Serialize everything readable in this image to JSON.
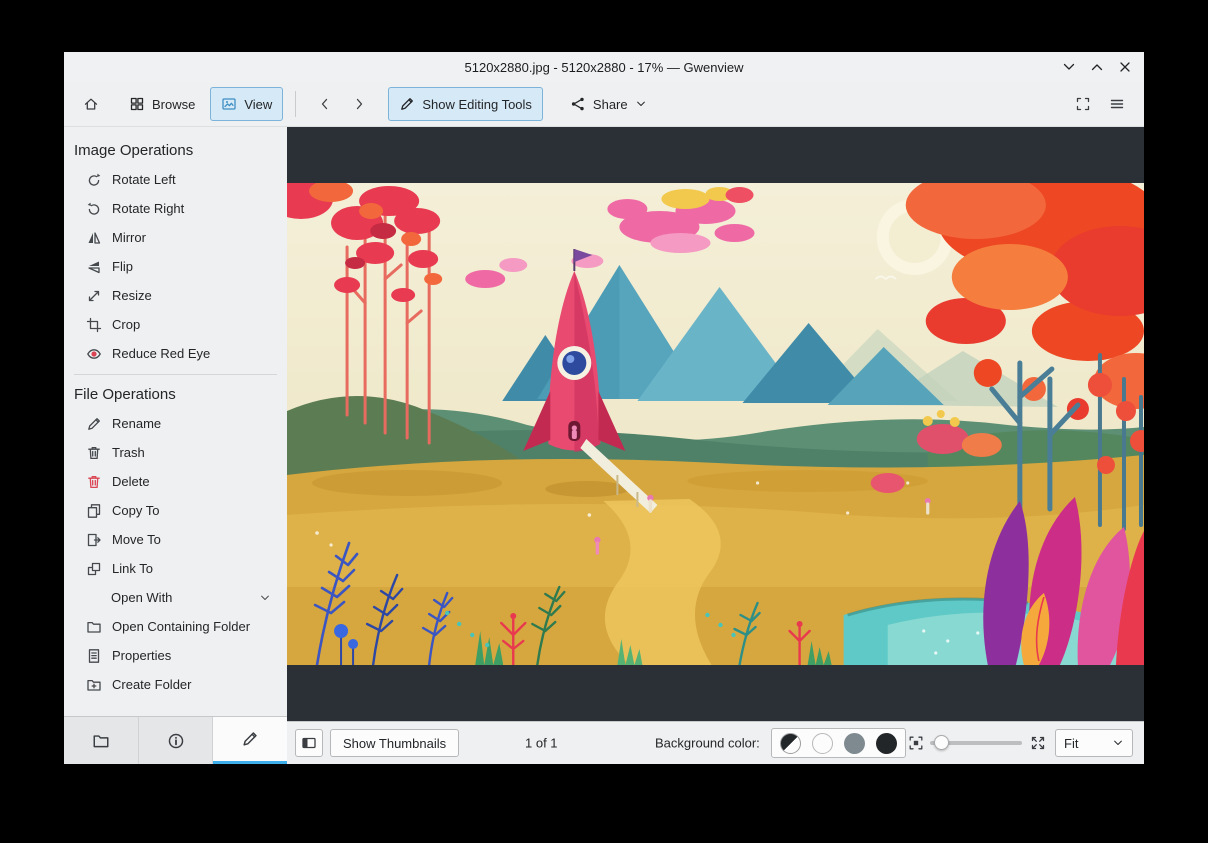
{
  "window": {
    "title": "5120x2880.jpg - 5120x2880 - 17% — Gwenview"
  },
  "toolbar": {
    "browse": "Browse",
    "view": "View",
    "show_editing_tools": "Show Editing Tools",
    "share": "Share"
  },
  "sidebar": {
    "image_operations_heading": "Image Operations",
    "image_operations": [
      {
        "label": "Rotate Left",
        "icon": "rotate-left-icon"
      },
      {
        "label": "Rotate Right",
        "icon": "rotate-right-icon"
      },
      {
        "label": "Mirror",
        "icon": "mirror-icon"
      },
      {
        "label": "Flip",
        "icon": "flip-icon"
      },
      {
        "label": "Resize",
        "icon": "resize-icon"
      },
      {
        "label": "Crop",
        "icon": "crop-icon"
      },
      {
        "label": "Reduce Red Eye",
        "icon": "red-eye-icon"
      }
    ],
    "file_operations_heading": "File Operations",
    "file_operations": [
      {
        "label": "Rename",
        "icon": "pencil-icon"
      },
      {
        "label": "Trash",
        "icon": "trash-icon"
      },
      {
        "label": "Delete",
        "icon": "delete-icon"
      },
      {
        "label": "Copy To",
        "icon": "copy-icon"
      },
      {
        "label": "Move To",
        "icon": "move-icon"
      },
      {
        "label": "Link To",
        "icon": "link-icon"
      },
      {
        "label": "Open With",
        "has_submenu": true
      },
      {
        "label": "Open Containing Folder",
        "icon": "folder-icon"
      },
      {
        "label": "Properties",
        "icon": "properties-icon"
      },
      {
        "label": "Create Folder",
        "icon": "new-folder-icon"
      }
    ]
  },
  "statusbar": {
    "show_thumbnails": "Show Thumbnails",
    "page_indicator": "1 of 1",
    "background_color_label": "Background color:",
    "zoom_mode": "Fit"
  },
  "icons": {
    "window_controls": [
      "minimize-chevron-down-icon",
      "maximize-chevron-up-icon",
      "close-x-icon"
    ],
    "toolbar": [
      "home-icon",
      "browse-grid-icon",
      "view-image-icon",
      "back-chevron-icon",
      "forward-chevron-icon",
      "pencil-icon",
      "share-icon",
      "fit-view-icon",
      "hamburger-menu-icon"
    ],
    "sidebar_tabs": [
      "folder-icon",
      "info-icon",
      "pencil-icon"
    ],
    "statusbar": [
      "thumbnail-bar-toggle-icon",
      "zoom-fit-icon",
      "zoom-actual-icon",
      "chevron-down-icon"
    ]
  },
  "colors": {
    "accent": "#3daee9",
    "chrome_bg": "#eff0f1",
    "canvas_bg": "#2b3036",
    "delete_red": "#da4453"
  }
}
